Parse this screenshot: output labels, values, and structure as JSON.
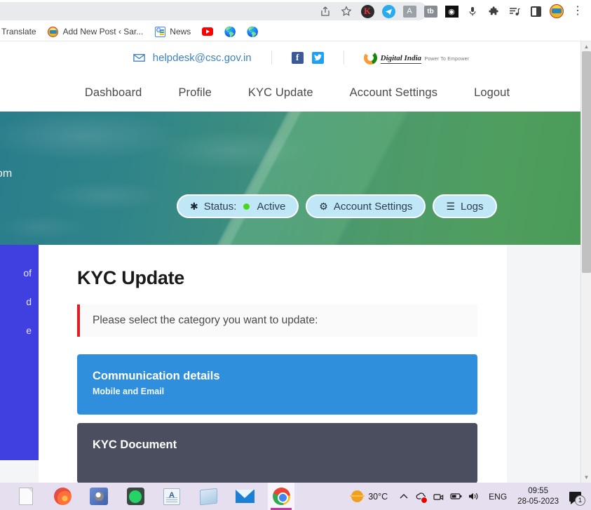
{
  "browser": {
    "toolbar_icons": [
      {
        "name": "share-icon",
        "label": "Share"
      },
      {
        "name": "bookmark-star-icon",
        "label": "Bookmark this tab"
      },
      {
        "name": "extension-kite-icon",
        "label": "K"
      },
      {
        "name": "extension-telegram-icon",
        "label": "Telegram"
      },
      {
        "name": "extension-printer-icon",
        "label": "Print"
      },
      {
        "name": "extension-tb-icon",
        "label": "tb"
      },
      {
        "name": "extension-owl-icon",
        "label": "Owl"
      },
      {
        "name": "microphone-icon",
        "label": "Microphone"
      },
      {
        "name": "extensions-puzzle-icon",
        "label": "Extensions"
      },
      {
        "name": "reading-list-icon",
        "label": "Reading list"
      },
      {
        "name": "side-panel-icon",
        "label": "Side panel"
      },
      {
        "name": "profile-avatar-icon",
        "label": "Profile"
      },
      {
        "name": "chrome-menu-icon",
        "label": "Customize and control Google Chrome"
      }
    ],
    "bookmarks": [
      {
        "label": "Translate",
        "icon": "translate-icon"
      },
      {
        "label": "Add New Post ‹ Sar...",
        "icon": "wordpress-emblem-icon"
      },
      {
        "label": "News",
        "icon": "google-news-icon"
      },
      {
        "label": "",
        "icon": "youtube-icon"
      },
      {
        "label": "",
        "icon": "globe-icon"
      },
      {
        "label": "",
        "icon": "globe-icon-2"
      }
    ]
  },
  "site": {
    "topbar": {
      "email": "helpdesk@csc.gov.in",
      "social": [
        {
          "name": "facebook-icon",
          "glyph": "f"
        },
        {
          "name": "twitter-icon",
          "glyph": "ᴠ"
        }
      ],
      "logo_title": "Digital India",
      "logo_subtitle": "Power To Empower"
    },
    "nav": [
      {
        "label": "Dashboard"
      },
      {
        "label": "Profile"
      },
      {
        "label": "KYC Update"
      },
      {
        "label": "Account Settings"
      },
      {
        "label": "Logout"
      }
    ],
    "hero": {
      "email_fragment": "@gmail.com",
      "pills": [
        {
          "label_prefix": "Status:",
          "label_suffix": "Active",
          "icon": "asterisk-icon",
          "status_color": "#4ad61a"
        },
        {
          "label": "Account Settings",
          "icon": "gears-icon"
        },
        {
          "label": "Logs",
          "icon": "list-icon"
        }
      ]
    },
    "side_panel_fragments": [
      "of",
      "d",
      "e"
    ],
    "main": {
      "title": "KYC Update",
      "notice": "Please select the category you want to update:",
      "notice_accent": "#e31c23",
      "categories": [
        {
          "title": "Communication details",
          "subtitle": "Mobile and Email",
          "color": "#2f8fdd"
        },
        {
          "title": "KYC Document",
          "subtitle": "",
          "color": "#4a4e5e"
        }
      ]
    }
  },
  "taskbar": {
    "apps": [
      {
        "name": "file-explorer-icon",
        "label": "File"
      },
      {
        "name": "firefox-icon",
        "label": "Firefox"
      },
      {
        "name": "media-player-icon",
        "label": "Media Player"
      },
      {
        "name": "whatsapp-icon",
        "label": "WhatsApp"
      },
      {
        "name": "document-app-icon",
        "label": "Document"
      },
      {
        "name": "notepad-icon",
        "label": "Notepad"
      },
      {
        "name": "mail-app-icon",
        "label": "Mail"
      },
      {
        "name": "chrome-icon",
        "label": "Google Chrome",
        "active": true
      }
    ],
    "tray": {
      "temperature": "30°C",
      "weather_icon": "sun-icon",
      "icons": [
        {
          "name": "show-hidden-icons-chevron",
          "glyph": "∧"
        },
        {
          "name": "network-error-icon",
          "glyph": "☁"
        },
        {
          "name": "camera-icon",
          "glyph": "▢"
        },
        {
          "name": "battery-icon",
          "glyph": "▭"
        },
        {
          "name": "volume-icon",
          "glyph": "🔊"
        }
      ],
      "language": "ENG",
      "time": "09:55",
      "date": "28-05-2023",
      "notification_count": "1"
    }
  }
}
